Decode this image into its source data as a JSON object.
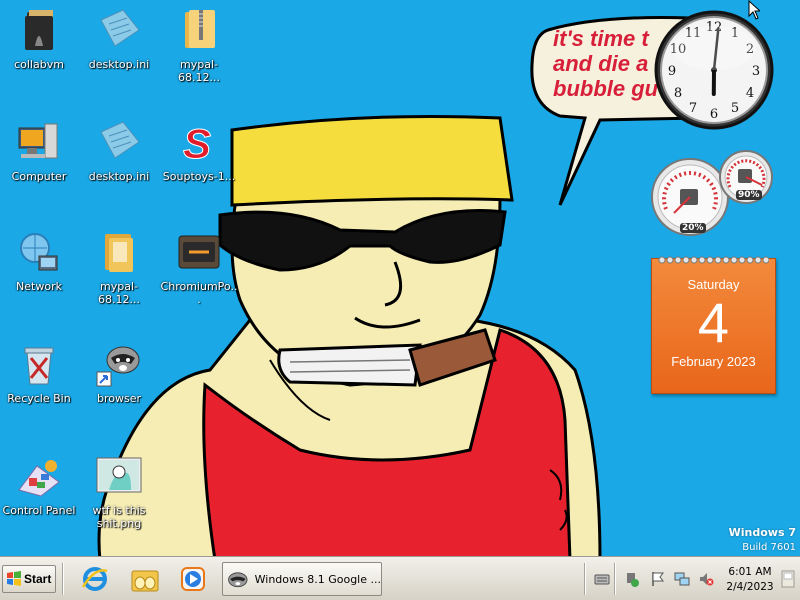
{
  "desktop": {
    "icons": [
      {
        "label": "collabvm",
        "icon": "folder-dark-icon"
      },
      {
        "label": "desktop.ini",
        "icon": "ini-file-icon"
      },
      {
        "label": "mypal-68.12...",
        "icon": "zip-folder-icon"
      },
      {
        "label": "Computer",
        "icon": "computer-icon"
      },
      {
        "label": "desktop.ini",
        "icon": "ini-file-icon"
      },
      {
        "label": "Souptoys-1...",
        "icon": "souptoys-icon"
      },
      {
        "label": "Network",
        "icon": "network-icon"
      },
      {
        "label": "mypal-68.12...",
        "icon": "folder-icon"
      },
      {
        "label": "ChromiumPo...",
        "icon": "chromium-portable-icon"
      },
      {
        "label": "Recycle Bin",
        "icon": "recycle-bin-icon"
      },
      {
        "label": "browser",
        "icon": "raccoon-shortcut-icon"
      },
      {
        "label": "Control Panel",
        "icon": "control-panel-icon"
      },
      {
        "label": "wtf is this shit.png",
        "icon": "image-file-icon"
      }
    ]
  },
  "wallpaper": {
    "bubble_text": "it's time t\nand die a\nbubble gu",
    "background_color": "#1aa8e6"
  },
  "gadgets": {
    "clock": {
      "hour": 6,
      "minute": 1
    },
    "meter": {
      "cpu_percent": "20%",
      "memory_percent": "90%"
    },
    "calendar": {
      "weekday": "Saturday",
      "day": "4",
      "month_year": "February 2023"
    }
  },
  "watermark": {
    "line1": "Windows 7",
    "line2": "Build 7601"
  },
  "taskbar": {
    "start_label": "Start",
    "pinned": [
      {
        "name": "internet-explorer-icon"
      },
      {
        "name": "libraries-folder-icon"
      },
      {
        "name": "media-player-icon"
      }
    ],
    "active_window_title": "Windows 8.1 Google ...",
    "tray": {
      "time": "6:01 AM",
      "date": "2/4/2023"
    }
  }
}
